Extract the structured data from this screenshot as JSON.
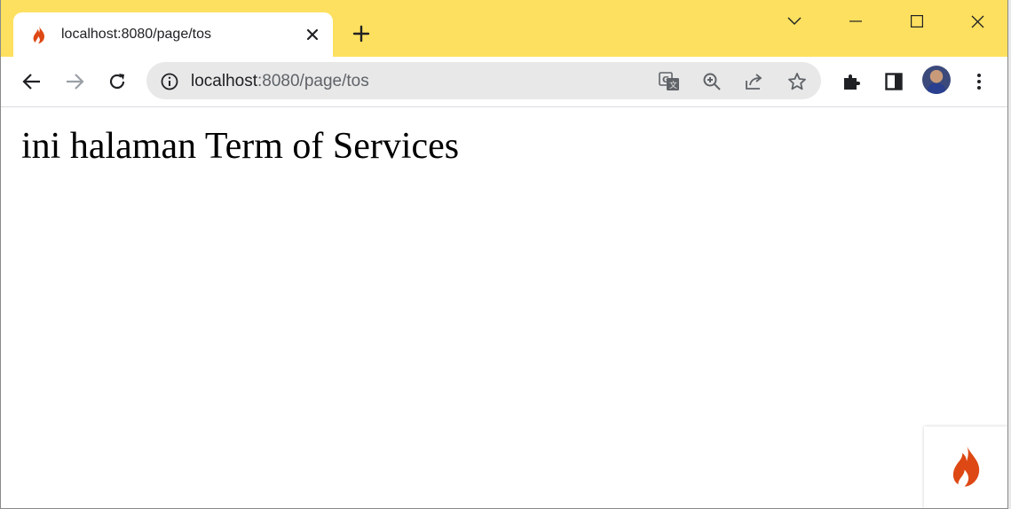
{
  "tab": {
    "title": "localhost:8080/page/tos",
    "favicon": "codeigniter-flame-icon"
  },
  "window_controls": {
    "tab_search": "chevron-down-icon",
    "minimize": "minimize-icon",
    "maximize": "maximize-icon",
    "close": "close-icon"
  },
  "toolbar": {
    "url_host": "localhost",
    "url_path": ":8080/page/tos",
    "icons": [
      "back-arrow-icon",
      "forward-arrow-icon",
      "reload-icon",
      "translate-icon",
      "zoom-icon",
      "share-icon",
      "bookmark-star-icon",
      "extensions-puzzle-icon",
      "side-panel-icon",
      "profile-avatar",
      "kebab-menu-icon"
    ]
  },
  "page": {
    "heading": "ini halaman Term of Services"
  },
  "colors": {
    "tabstrip": "#fde05f",
    "omnibox": "#e8e8e8",
    "flame": "#dd4814"
  }
}
